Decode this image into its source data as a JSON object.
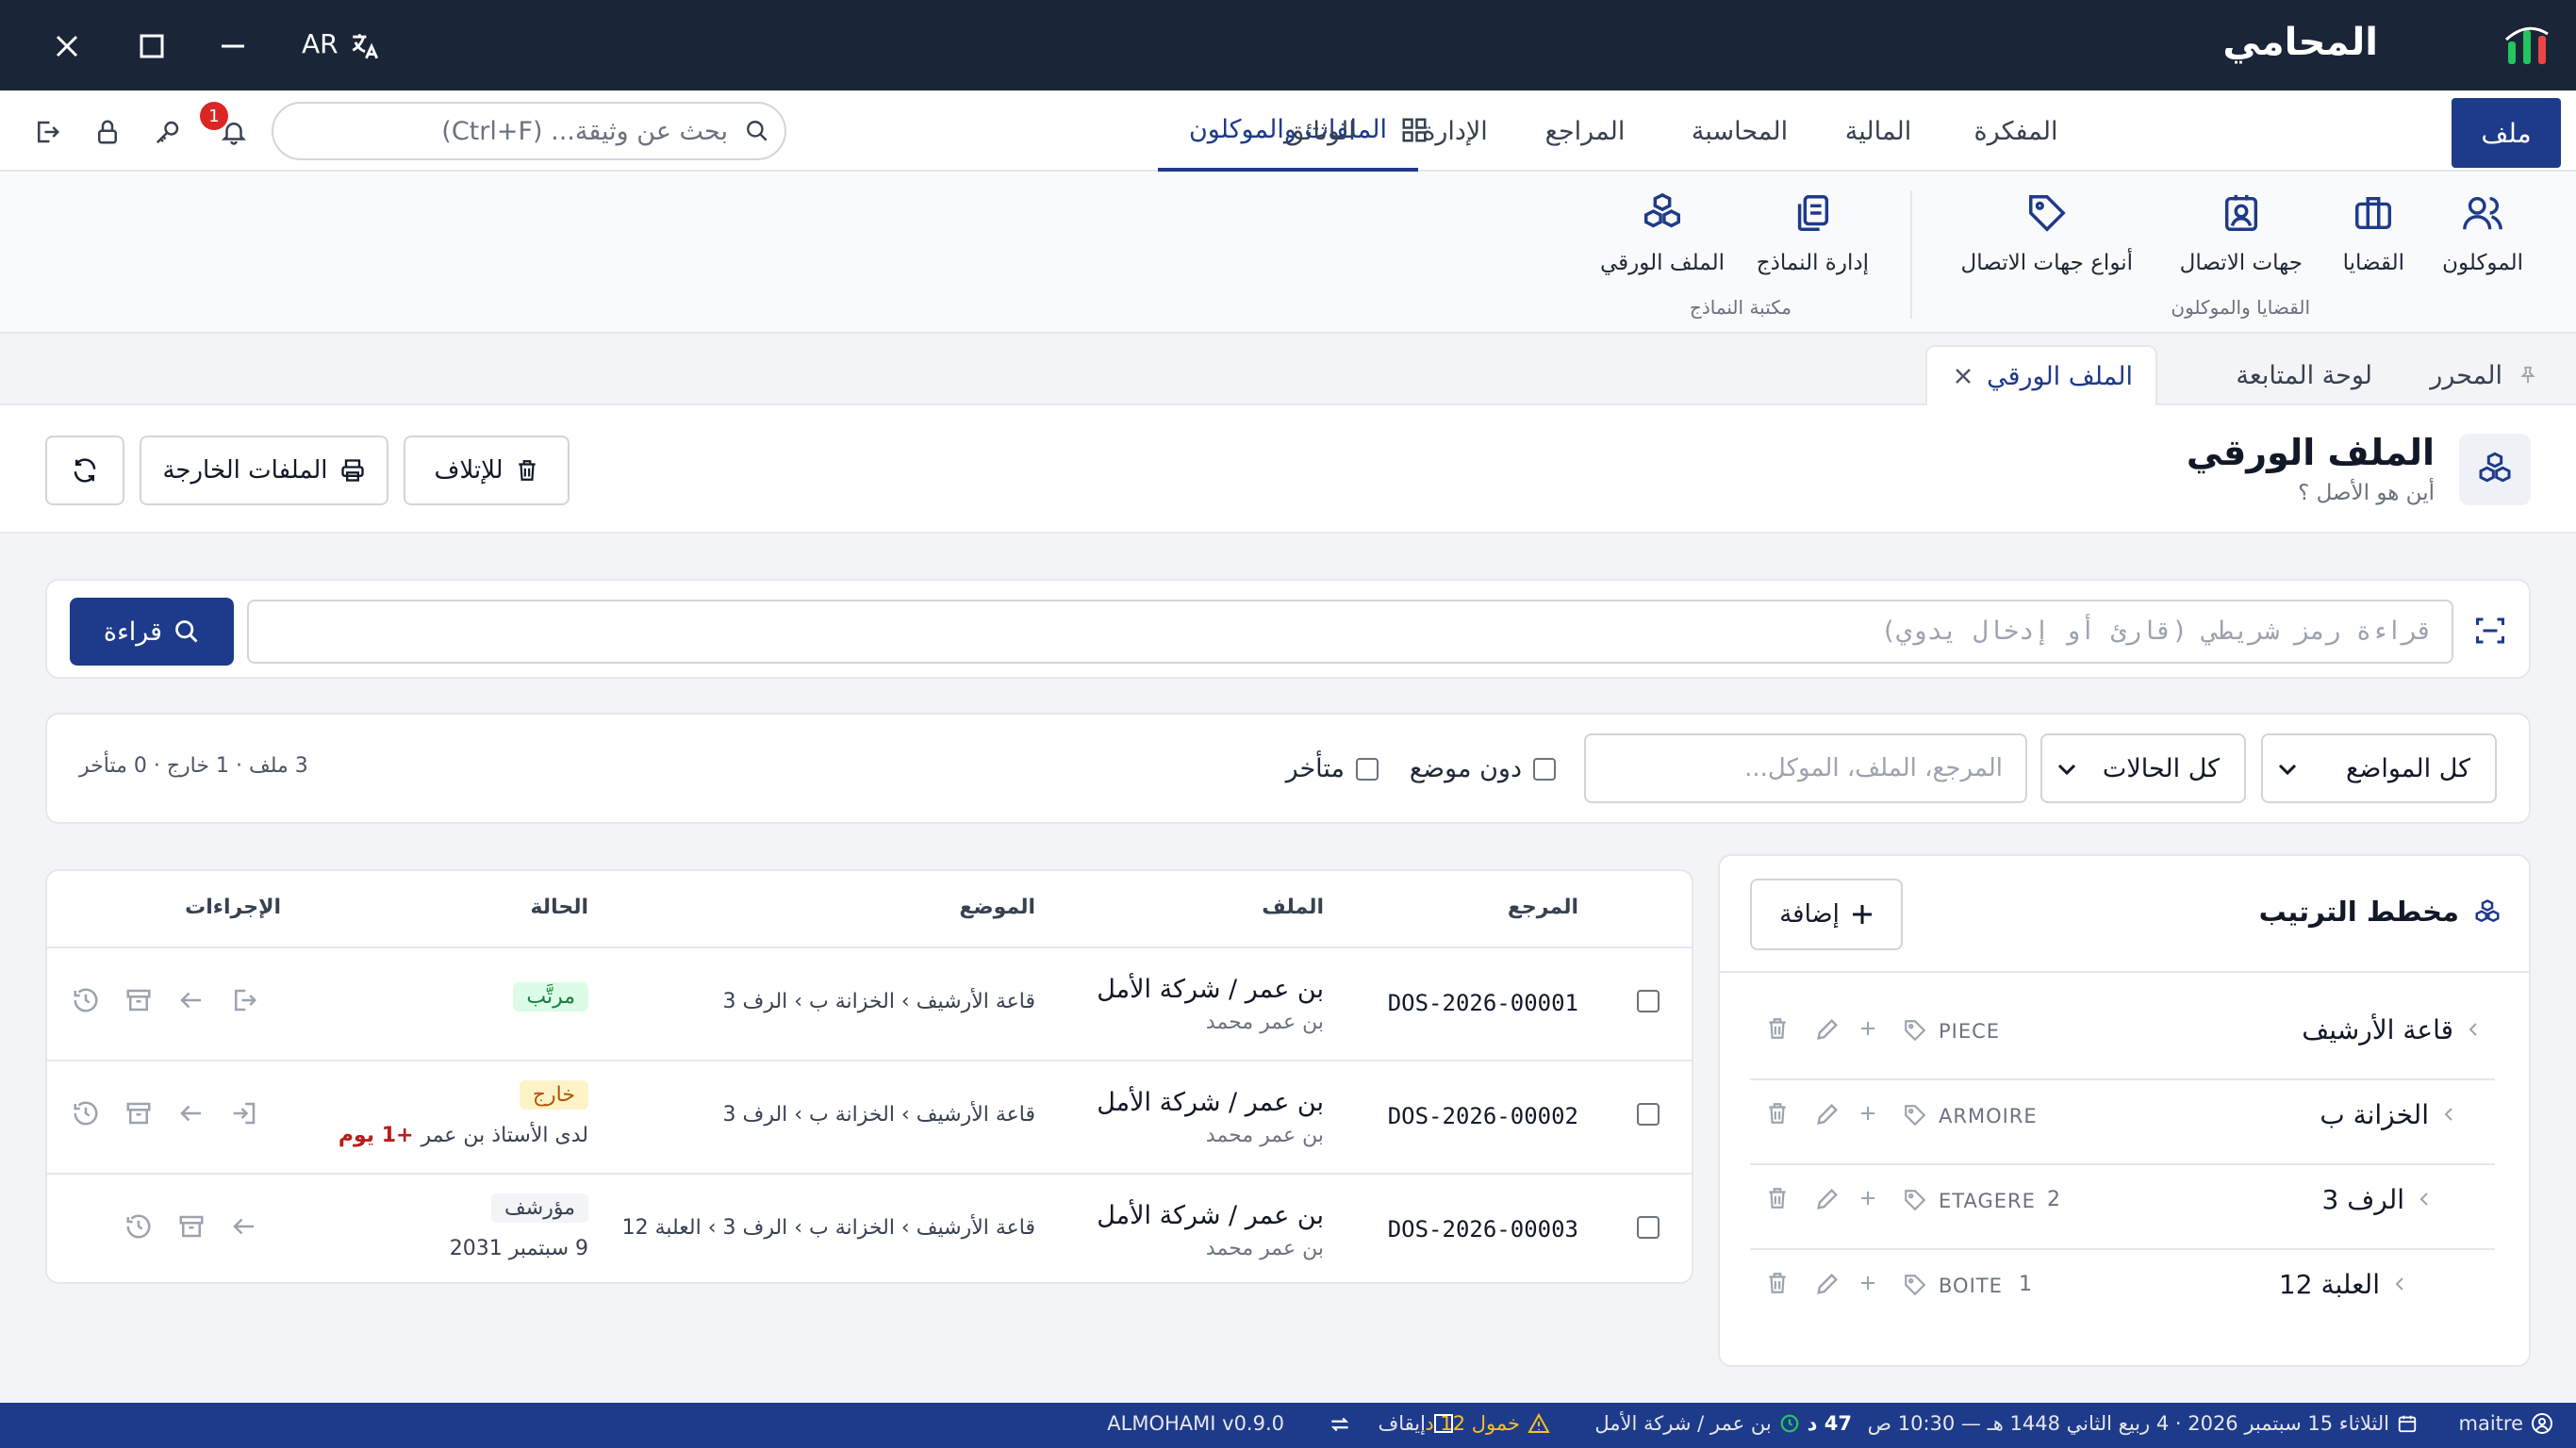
{
  "app": {
    "title": "المحامي",
    "lang": "AR"
  },
  "menu": {
    "tabs": [
      "ملف",
      "الملفات والموكلون",
      "المفكرة",
      "المالية",
      "المحاسبة",
      "المراجع",
      "الإدارة",
      "الوثائق"
    ],
    "search_placeholder": "بحث عن وثيقة... (Ctrl+F)",
    "notif_count": "1"
  },
  "ribbon": {
    "group1": {
      "label": "القضايا والموكلون",
      "items": [
        "الموكلون",
        "القضايا",
        "جهات الاتصال",
        "أنواع جهات الاتصال"
      ]
    },
    "group2": {
      "label": "مكتبة النماذج",
      "items": [
        "إدارة النماذج",
        "الملف الورقي"
      ]
    }
  },
  "doc_tabs": [
    "المحرر",
    "لوحة المتابعة",
    "الملف الورقي"
  ],
  "page": {
    "title": "الملف الورقي",
    "subtitle": "أين هو الأصل ؟",
    "btn_destroy": "للإتلاف",
    "btn_out": "الملفات الخارجة"
  },
  "scan": {
    "placeholder": "قراءة رمز شريطي (قارئ أو إدخال يدوي)",
    "btn": "قراءة"
  },
  "filters": {
    "locations": "كل المواضع",
    "states": "كل الحالات",
    "search_placeholder": "المرجع، الملف، الموكل...",
    "no_location": "دون موضع",
    "late": "متأخر",
    "summary": "3 ملف · 1 خارج · 0 متأخر"
  },
  "tree": {
    "title": "مخطط الترتيب",
    "add": "إضافة",
    "nodes": [
      {
        "name": "قاعة الأرشيف",
        "type": "PIECE",
        "num": ""
      },
      {
        "name": "الخزانة ب",
        "type": "ARMOIRE",
        "num": ""
      },
      {
        "name": "الرف 3",
        "type": "ETAGERE",
        "num": "2"
      },
      {
        "name": "العلبة 12",
        "type": "BOITE",
        "num": "1"
      }
    ]
  },
  "table": {
    "headers": [
      "المرجع",
      "الملف",
      "الموضع",
      "الحالة",
      "الإجراءات"
    ],
    "rows": [
      {
        "ref": "DOS-2026-00001",
        "file": "بن عمر / شركة الأمل",
        "client": "بن عمر محمد",
        "loc": "قاعة الأرشيف › الخزانة ب › الرف 3",
        "status": "مرتَّب",
        "note": "",
        "late": ""
      },
      {
        "ref": "DOS-2026-00002",
        "file": "بن عمر / شركة الأمل",
        "client": "بن عمر محمد",
        "loc": "قاعة الأرشيف › الخزانة ب › الرف 3",
        "status": "خارج",
        "note": "لدى الأستاذ بن عمر",
        "late": "+1 يوم"
      },
      {
        "ref": "DOS-2026-00003",
        "file": "بن عمر / شركة الأمل",
        "client": "بن عمر محمد",
        "loc": "قاعة الأرشيف › الخزانة ب › الرف 3 › العلبة 12",
        "status": "مؤرشف",
        "note": "9 سبتمبر 2031",
        "late": ""
      }
    ]
  },
  "status": {
    "user": "maitre",
    "date": "الثلاثاء 15 سبتمبر 2026 · 4 ربيع الثاني 1448 هـ — 10:30 ص",
    "timer": "47 د",
    "file": "بن عمر / شركة الأمل",
    "warn": "خمول 12 د",
    "pause": "إيقاف",
    "version": "ALMOHAMI v0.9.0"
  },
  "colors": {
    "navy": "#1e3a8a",
    "titlebar": "#1b2538",
    "ok": "#16a34a",
    "warn": "#d97706",
    "late": "#dc2626"
  }
}
